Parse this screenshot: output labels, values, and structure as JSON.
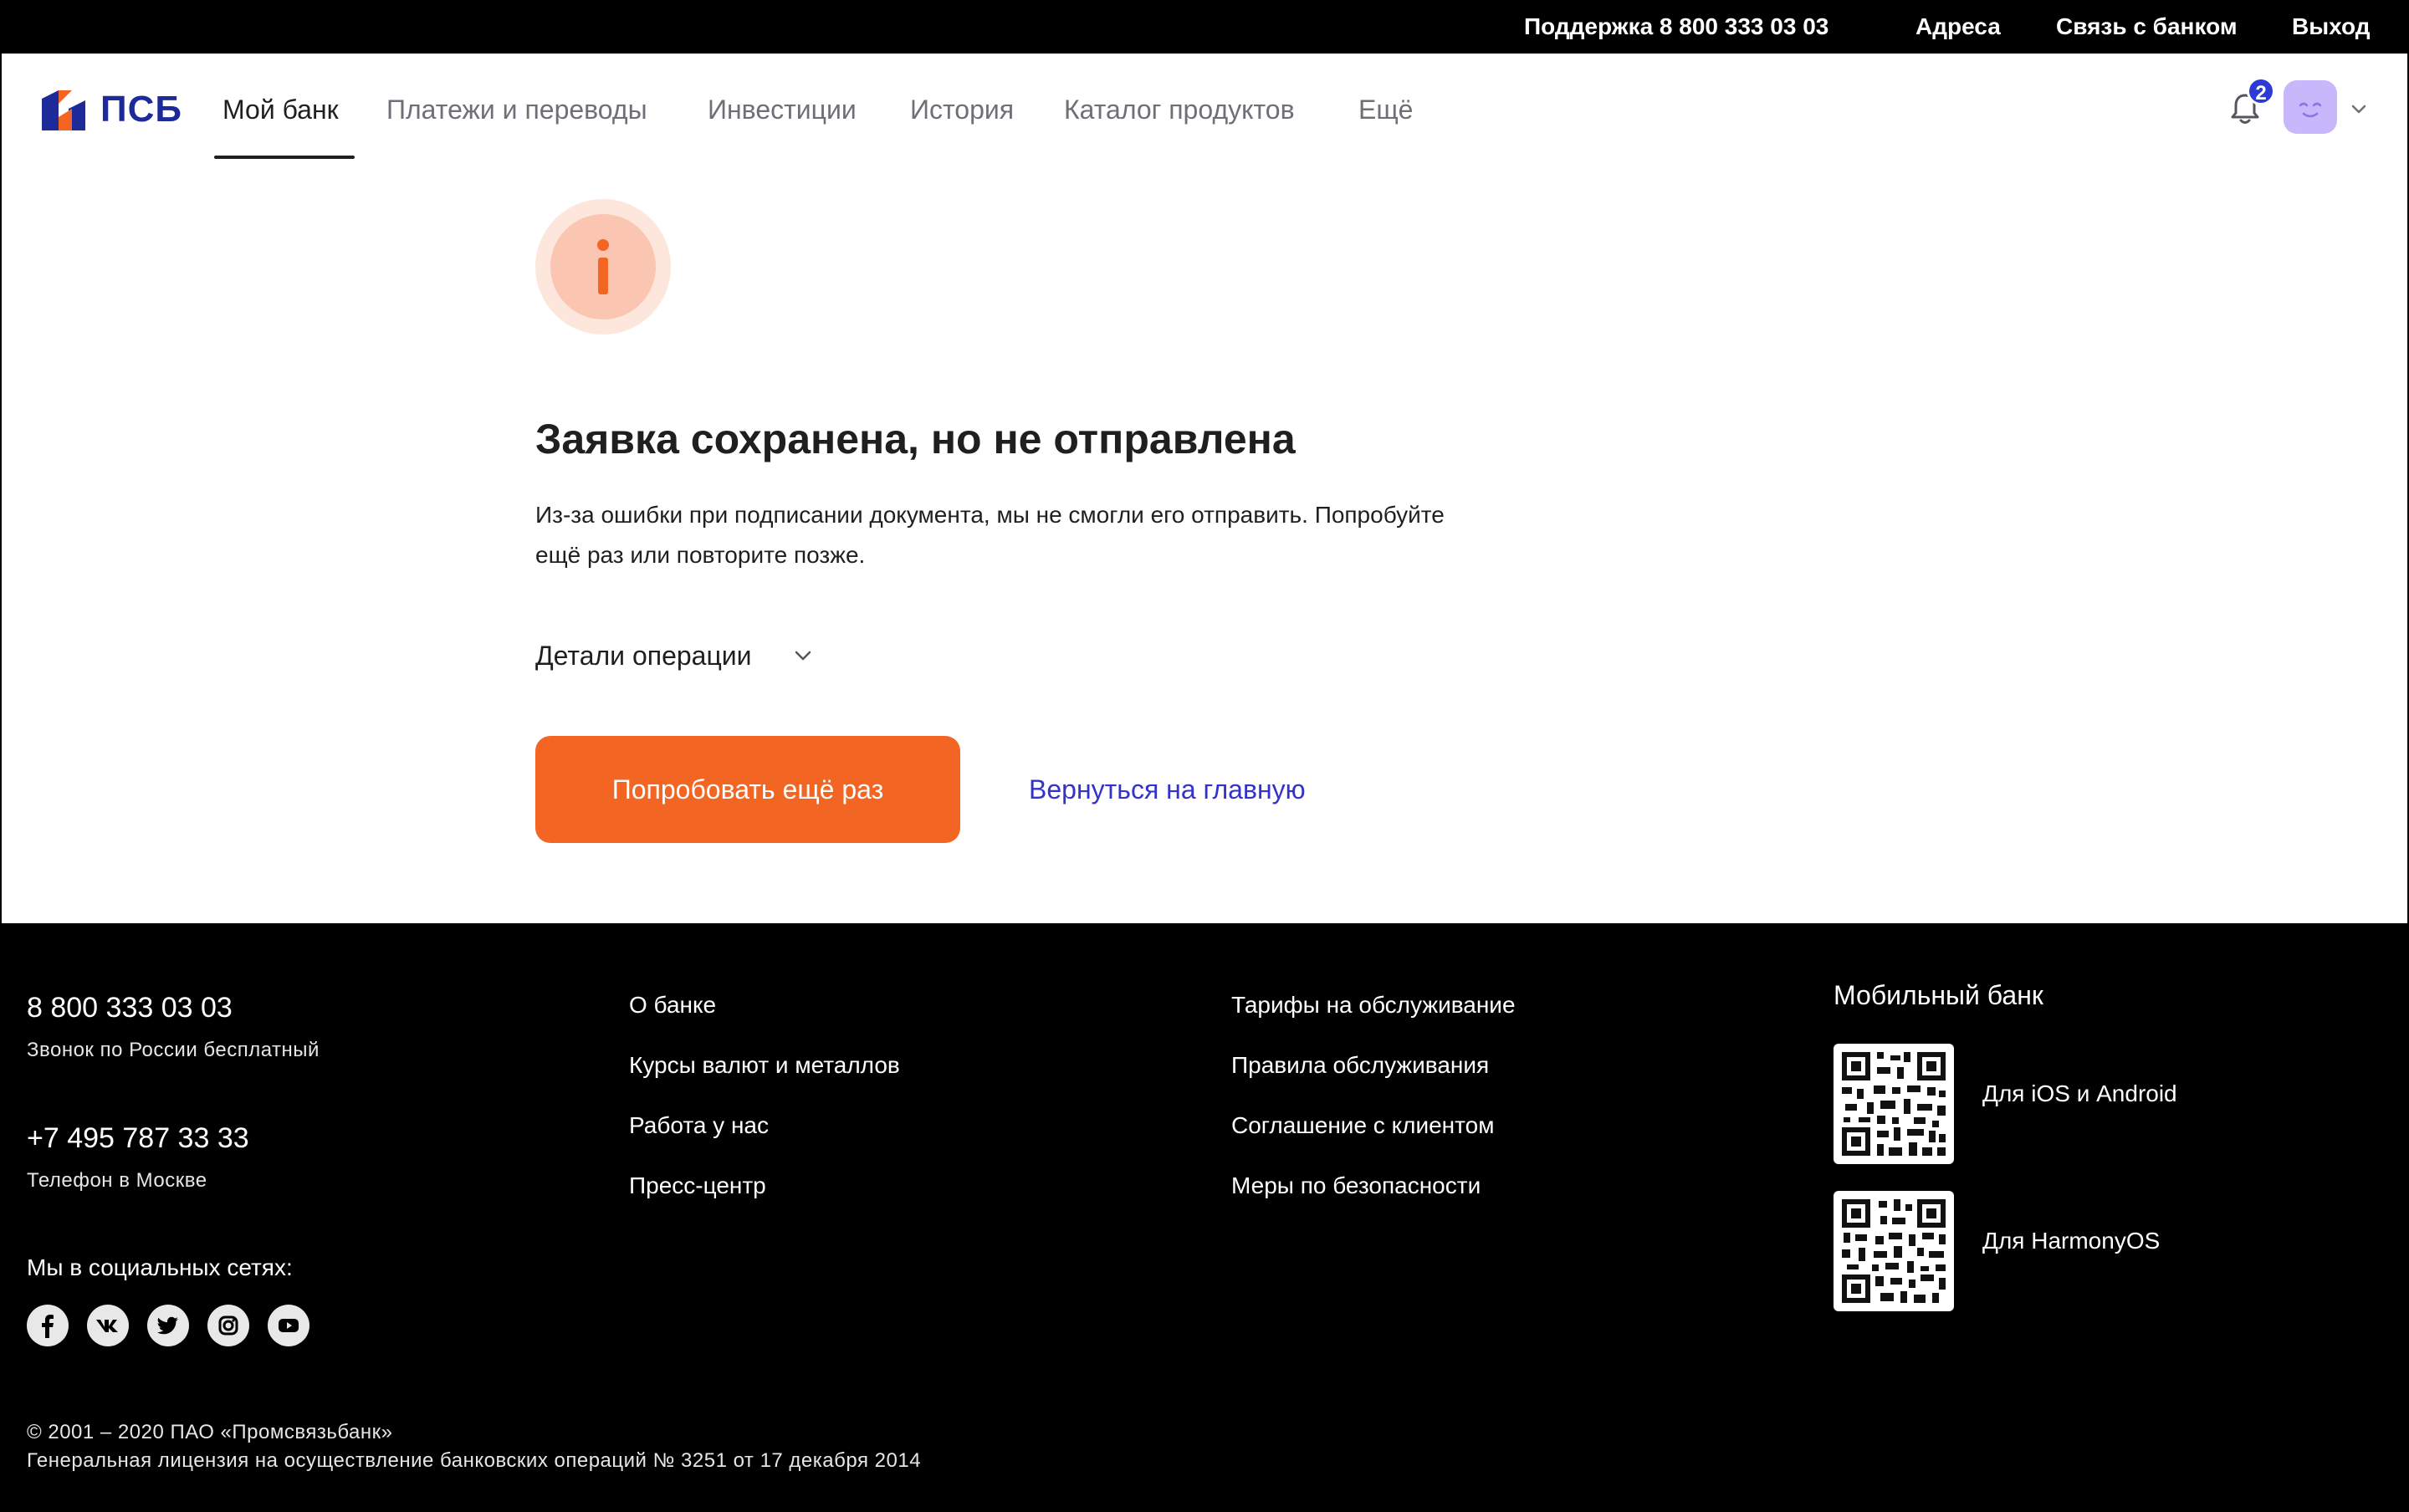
{
  "topbar": {
    "support": "Поддержка 8 800 333 03 03",
    "addresses": "Адреса",
    "contact_bank": "Связь с банком",
    "logout": "Выход"
  },
  "header": {
    "logo_text": "ПСБ",
    "nav": [
      "Мой банк",
      "Платежи и переводы",
      "Инвестиции",
      "История",
      "Каталог продуктов",
      "Ещё"
    ],
    "active_nav": "Мой банк",
    "notifications_count": "2"
  },
  "main": {
    "icon": "info-icon",
    "title": "Заявка сохранена, но не отправлена",
    "description_line1": "Из-за ошибки при подписании документа, мы не смогли его отправить. Попробуйте",
    "description_line2": "ещё раз или повторите позже.",
    "details_label": "Детали операции",
    "retry_button": "Попробовать ещё раз",
    "home_link": "Вернуться на главную"
  },
  "footer": {
    "phone1": "8 800 333 03 03",
    "phone1_note": "Звонок по России бесплатный",
    "phone2": "+7 495 787 33 33",
    "phone2_note": "Телефон в Москве",
    "social_label": "Мы в социальных сетях:",
    "social_icons": [
      "facebook-icon",
      "vk-icon",
      "twitter-icon",
      "instagram-icon",
      "youtube-icon"
    ],
    "col2": [
      "О банке",
      "Курсы валют и металлов",
      "Работа у нас",
      "Пресс-центр"
    ],
    "col3": [
      "Тарифы на обслуживание",
      "Правила обслуживания",
      "Соглашение с клиентом",
      "Меры по безопасности"
    ],
    "mobile_title": "Мобильный банк",
    "qr1_label": "Для iOS и Android",
    "qr2_label": "Для HarmonyOS",
    "copyright_line1": "© 2001 – 2020 ПАО «Промсвязьбанк»",
    "copyright_line2": "Генеральная лицензия на осуществление банковских операций № 3251 от 17 декабря 2014"
  },
  "colors": {
    "accent": "#f26522",
    "brand_blue": "#1e2a9a",
    "link": "#3333cc",
    "badge": "#2c3bd6",
    "avatar": "#c9b7fb"
  }
}
